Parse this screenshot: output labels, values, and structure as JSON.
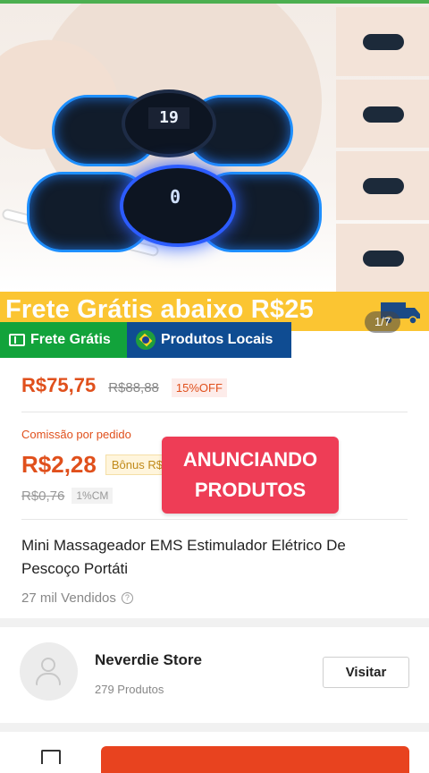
{
  "product_image": {
    "banner_text": "Frete Grátis abaixo R$25",
    "counter": "1/7"
  },
  "tags": {
    "free_shipping": "Frete Grátis",
    "local_products": "Produtos Locais"
  },
  "pricing": {
    "price": "R$75,75",
    "old_price": "R$88,88",
    "discount": "15%OFF"
  },
  "commission": {
    "label": "Comissão por pedido",
    "value": "R$2,28",
    "bonus": "Bônus R$",
    "old_value": "R$0,76",
    "percent": "1%CM"
  },
  "overlay": {
    "line1": "ANUNCIANDO",
    "line2": "PRODUTOS"
  },
  "product": {
    "title": "Mini Massageador EMS Estimulador Elétrico De Pescoço Portáti",
    "sold": "27 mil Vendidos"
  },
  "store": {
    "name": "Neverdie Store",
    "products": "279 Produtos",
    "visit_label": "Visitar"
  },
  "colors": {
    "accent": "#e0501c",
    "banner": "#fbc532",
    "tag_green": "#12a33b",
    "tag_blue": "#0f4c92",
    "overlay": "#ee3d56"
  }
}
